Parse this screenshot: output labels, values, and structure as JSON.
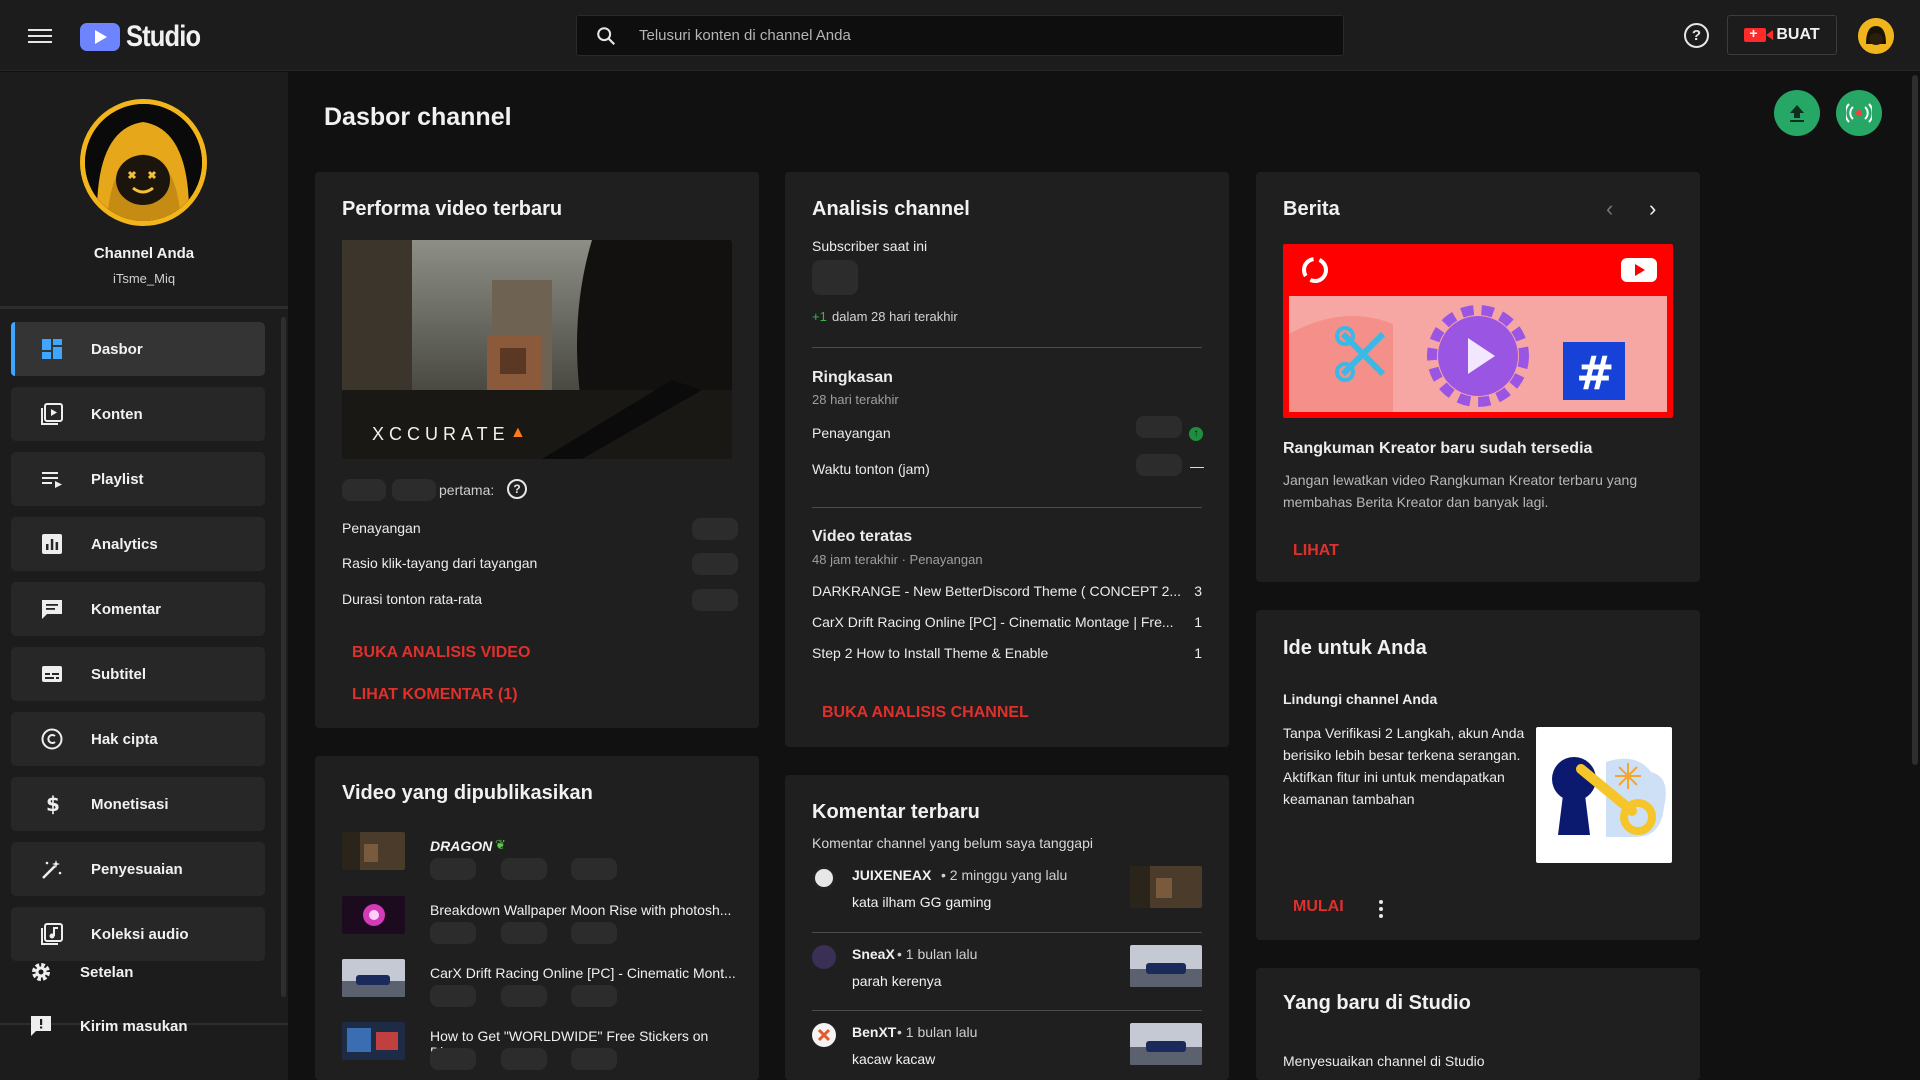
{
  "app": {
    "title": "Studio"
  },
  "search": {
    "placeholder": "Telusuri konten di channel Anda"
  },
  "header": {
    "help": "?",
    "create_label": "BUAT"
  },
  "channel": {
    "name": "Channel Anda",
    "handle": "iTsme_Miq"
  },
  "sidebar": {
    "items": [
      {
        "label": "Dasbor",
        "icon": "dashboard-icon",
        "active": true
      },
      {
        "label": "Konten",
        "icon": "content-icon"
      },
      {
        "label": "Playlist",
        "icon": "playlist-icon"
      },
      {
        "label": "Analytics",
        "icon": "analytics-icon"
      },
      {
        "label": "Komentar",
        "icon": "comments-icon"
      },
      {
        "label": "Subtitel",
        "icon": "subtitles-icon"
      },
      {
        "label": "Hak cipta",
        "icon": "copyright-icon"
      },
      {
        "label": "Monetisasi",
        "icon": "monetization-icon"
      },
      {
        "label": "Penyesuaian",
        "icon": "customization-icon"
      },
      {
        "label": "Koleksi audio",
        "icon": "audio-library-icon"
      }
    ],
    "bottom": [
      {
        "label": "Setelan",
        "icon": "settings-icon"
      },
      {
        "label": "Kirim masukan",
        "icon": "feedback-icon"
      }
    ]
  },
  "page": {
    "title": "Dasbor channel"
  },
  "performance": {
    "title": "Performa video terbaru",
    "thumb_text": "XCCURATE",
    "period_suffix": "pertama:",
    "metrics": [
      {
        "label": "Penayangan"
      },
      {
        "label": "Rasio klik-tayang dari tayangan"
      },
      {
        "label": "Durasi tonton rata-rata"
      }
    ],
    "link_analytics": "BUKA ANALISIS VIDEO",
    "link_comments": "LIHAT KOMENTAR (1)"
  },
  "published": {
    "title": "Video yang dipublikasikan",
    "videos": [
      {
        "title": "DRAGON"
      },
      {
        "title": "Breakdown Wallpaper Moon Rise with photosh..."
      },
      {
        "title": "CarX Drift Racing Online [PC] - Cinematic Mont..."
      },
      {
        "title": "How to Get \"WORLDWIDE\" Free Stickers on Dis..."
      }
    ]
  },
  "analytics": {
    "title": "Analisis channel",
    "subscriber_label": "Subscriber saat ini",
    "change_value": "+1",
    "change_text": "dalam 28 hari terakhir",
    "summary_title": "Ringkasan",
    "summary_period": "28 hari terakhir",
    "summary_rows": [
      {
        "label": "Penayangan",
        "trend": "up"
      },
      {
        "label": "Waktu tonton (jam)",
        "trend": "—"
      }
    ],
    "top_title": "Video teratas",
    "top_period": "48 jam terakhir · Penayangan",
    "top_videos": [
      {
        "title": "DARKRANGE - New BetterDiscord Theme ( CONCEPT 2...",
        "views": "3"
      },
      {
        "title": "CarX Drift Racing Online [PC] - Cinematic Montage | Fre...",
        "views": "1"
      },
      {
        "title": "Step 2 How to Install Theme & Enable",
        "views": "1"
      }
    ],
    "link": "BUKA ANALISIS CHANNEL"
  },
  "comments": {
    "title": "Komentar terbaru",
    "subtitle": "Komentar channel yang belum saya tanggapi",
    "items": [
      {
        "author": "JUIXENEAX",
        "time": "• 2 minggu yang lalu",
        "text": "kata ilham GG gaming"
      },
      {
        "author": "SneaX",
        "time": "• 1 bulan lalu",
        "text": "parah kerenya"
      },
      {
        "author": "BenXT",
        "time": "• 1 bulan lalu",
        "text": "kacaw kacaw"
      }
    ]
  },
  "news": {
    "title": "Berita",
    "headline": "Rangkuman Kreator baru sudah tersedia",
    "body": "Jangan lewatkan video Rangkuman Kreator terbaru yang membahas Berita Kreator dan banyak lagi.",
    "link": "LIHAT"
  },
  "ideas": {
    "title": "Ide untuk Anda",
    "subtitle": "Lindungi channel Anda",
    "body": "Tanpa Verifikasi 2 Langkah, akun Anda berisiko lebih besar terkena serangan. Aktifkan fitur ini untuk mendapatkan keamanan tambahan",
    "link": "MULAI"
  },
  "whats_new": {
    "title": "Yang baru di Studio",
    "item": "Menyesuaikan channel di Studio"
  },
  "colors": {
    "accent_red": "#e0302c",
    "brand_blue": "#6e84ff",
    "green": "#27a765"
  }
}
